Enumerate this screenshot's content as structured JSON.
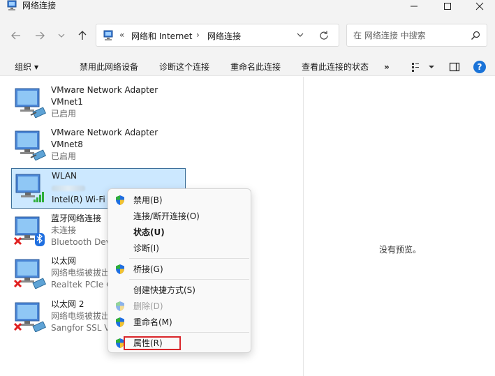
{
  "window": {
    "title": "网络连接",
    "buttons": {
      "minimize": "—",
      "maximize": "☐",
      "close": "✕"
    }
  },
  "address": {
    "crumbs": [
      "«",
      "网络和 Internet",
      "›",
      "网络连接"
    ]
  },
  "search": {
    "placeholder": "在 网络连接 中搜索"
  },
  "commands": {
    "organize": "组织",
    "disable": "禁用此网络设备",
    "diagnose": "诊断这个连接",
    "rename": "重命名此连接",
    "status": "查看此连接的状态",
    "more": "»",
    "help": "?"
  },
  "connections": [
    {
      "name": "VMware Network Adapter",
      "line2": "VMnet1",
      "line3": "已启用",
      "icon": "ethernet-adapter-icon",
      "state": "enabled"
    },
    {
      "name": "VMware Network Adapter",
      "line2": "VMnet8",
      "line3": "已启用",
      "icon": "ethernet-adapter-icon",
      "state": "enabled"
    },
    {
      "name": "WLAN",
      "line2": "",
      "line3": "Intel(R) Wi-Fi 6",
      "icon": "wifi-adapter-icon",
      "state": "selected"
    },
    {
      "name": "蓝牙网络连接",
      "line2": "未连接",
      "line3": "Bluetooth Dev",
      "icon": "bluetooth-adapter-icon",
      "state": "disconnected"
    },
    {
      "name": "以太网",
      "line2": "网络电缆被拔出",
      "line3": "Realtek PCIe G",
      "icon": "ethernet-adapter-icon",
      "state": "disconnected"
    },
    {
      "name": "以太网 2",
      "line2": "网络电缆被拔出",
      "line3": "Sangfor SSL V",
      "icon": "ethernet-adapter-icon",
      "state": "disconnected"
    }
  ],
  "preview": {
    "text": "没有预览。"
  },
  "context_menu": {
    "items": [
      {
        "label": "禁用(B)",
        "shield": true
      },
      {
        "label": "连接/断开连接(O)",
        "shield": false
      },
      {
        "label": "状态(U)",
        "shield": false,
        "bold": true
      },
      {
        "label": "诊断(I)",
        "shield": false
      },
      {
        "label": "桥接(G)",
        "shield": true
      },
      {
        "label": "创建快捷方式(S)",
        "shield": false
      },
      {
        "label": "删除(D)",
        "shield": true,
        "disabled": true
      },
      {
        "label": "重命名(M)",
        "shield": true
      },
      {
        "label": "属性(R)",
        "shield": true,
        "highlighted": true
      }
    ]
  },
  "colors": {
    "highlight_box": "#d9262b",
    "selection_bg": "#cce8ff",
    "help_blue": "#1a73d8"
  }
}
